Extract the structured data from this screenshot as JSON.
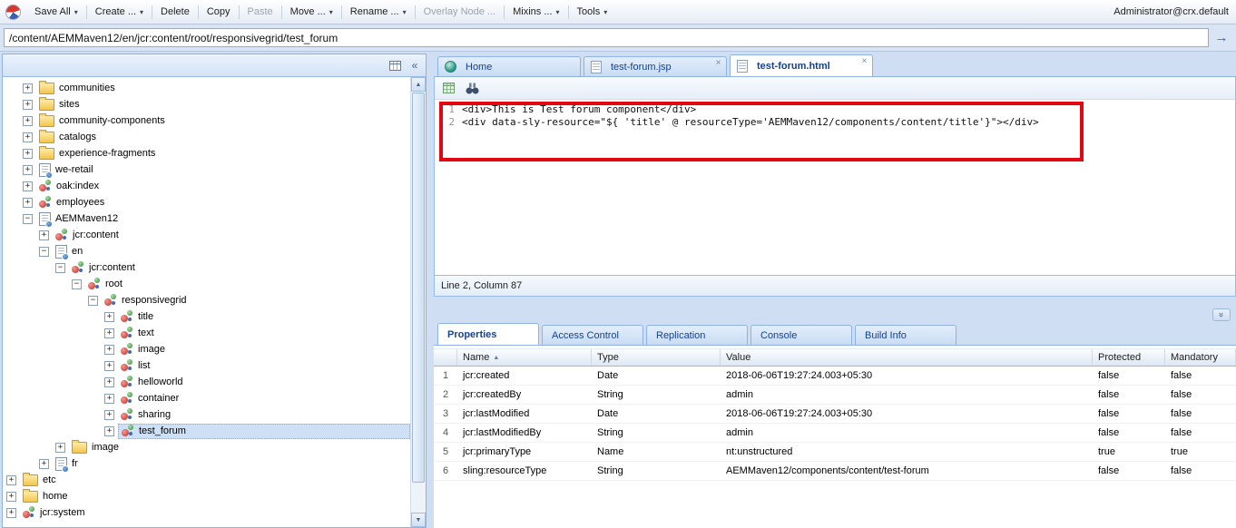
{
  "app": {
    "user": "Administrator@crx.default"
  },
  "toolbar": {
    "items": [
      {
        "label": "Save All",
        "arrow": true,
        "disabled": false
      },
      {
        "label": "Create ...",
        "arrow": true,
        "disabled": false
      },
      {
        "label": "Delete",
        "arrow": false,
        "disabled": false
      },
      {
        "label": "Copy",
        "arrow": false,
        "disabled": false
      },
      {
        "label": "Paste",
        "arrow": false,
        "disabled": true
      },
      {
        "label": "Move ...",
        "arrow": true,
        "disabled": false
      },
      {
        "label": "Rename ...",
        "arrow": true,
        "disabled": false
      },
      {
        "label": "Overlay Node ...",
        "arrow": false,
        "disabled": true
      },
      {
        "label": "Mixins ...",
        "arrow": true,
        "disabled": false
      },
      {
        "label": "Tools",
        "arrow": true,
        "disabled": false
      }
    ]
  },
  "address_bar": {
    "value": "/content/AEMMaven12/en/jcr:content/root/responsivegrid/test_forum"
  },
  "tree": {
    "items": [
      {
        "label": "communities",
        "level": 2,
        "icon": "folder",
        "expander": "plus"
      },
      {
        "label": "sites",
        "level": 2,
        "icon": "folder",
        "expander": "plus"
      },
      {
        "label": "community-components",
        "level": 2,
        "icon": "folder",
        "expander": "plus"
      },
      {
        "label": "catalogs",
        "level": 2,
        "icon": "folder",
        "expander": "plus"
      },
      {
        "label": "experience-fragments",
        "level": 2,
        "icon": "folder",
        "expander": "plus"
      },
      {
        "label": "we-retail",
        "level": 2,
        "icon": "page",
        "expander": "plus"
      },
      {
        "label": "oak:index",
        "level": 2,
        "icon": "node",
        "expander": "plus"
      },
      {
        "label": "employees",
        "level": 2,
        "icon": "node",
        "expander": "plus"
      },
      {
        "label": "AEMMaven12",
        "level": 2,
        "icon": "page",
        "expander": "minus"
      },
      {
        "label": "jcr:content",
        "level": 3,
        "icon": "node",
        "expander": "plus"
      },
      {
        "label": "en",
        "level": 3,
        "icon": "page",
        "expander": "minus"
      },
      {
        "label": "jcr:content",
        "level": 4,
        "icon": "node",
        "expander": "minus"
      },
      {
        "label": "root",
        "level": 5,
        "icon": "node",
        "expander": "minus"
      },
      {
        "label": "responsivegrid",
        "level": 6,
        "icon": "node",
        "expander": "minus"
      },
      {
        "label": "title",
        "level": 7,
        "icon": "node",
        "expander": "plus"
      },
      {
        "label": "text",
        "level": 7,
        "icon": "node",
        "expander": "plus"
      },
      {
        "label": "image",
        "level": 7,
        "icon": "node",
        "expander": "plus"
      },
      {
        "label": "list",
        "level": 7,
        "icon": "node",
        "expander": "plus"
      },
      {
        "label": "helloworld",
        "level": 7,
        "icon": "node",
        "expander": "plus"
      },
      {
        "label": "container",
        "level": 7,
        "icon": "node",
        "expander": "plus"
      },
      {
        "label": "sharing",
        "level": 7,
        "icon": "node",
        "expander": "plus"
      },
      {
        "label": "test_forum",
        "level": 7,
        "icon": "node",
        "expander": "plus",
        "selected": true
      },
      {
        "label": "image",
        "level": 4,
        "icon": "folder",
        "expander": "plus"
      },
      {
        "label": "fr",
        "level": 3,
        "icon": "page",
        "expander": "plus"
      },
      {
        "label": "etc",
        "level": 1,
        "icon": "folder",
        "expander": "plus"
      },
      {
        "label": "home",
        "level": 1,
        "icon": "folder",
        "expander": "plus"
      },
      {
        "label": "jcr:system",
        "level": 1,
        "icon": "node",
        "expander": "plus"
      }
    ]
  },
  "editor": {
    "tabs": [
      {
        "label": "Home",
        "icon": "home",
        "closable": false,
        "active": false
      },
      {
        "label": "test-forum.jsp",
        "icon": "file",
        "closable": true,
        "active": false
      },
      {
        "label": "test-forum.html",
        "icon": "file",
        "closable": true,
        "active": true
      }
    ],
    "lines": [
      {
        "number": "1",
        "code": "<div>This is Test forum component</div>"
      },
      {
        "number": "2",
        "code": "<div data-sly-resource=\"${ 'title' @ resourceType='AEMMaven12/components/content/title'}\"></div>"
      }
    ],
    "status": "Line 2, Column 87"
  },
  "bottom_panel": {
    "tabs": [
      {
        "label": "Properties",
        "active": true
      },
      {
        "label": "Access Control",
        "active": false
      },
      {
        "label": "Replication",
        "active": false
      },
      {
        "label": "Console",
        "active": false
      },
      {
        "label": "Build Info",
        "active": false
      }
    ],
    "table": {
      "columns": [
        "Name",
        "Type",
        "Value",
        "Protected",
        "Mandatory"
      ],
      "rows": [
        {
          "num": "1",
          "name": "jcr:created",
          "type": "Date",
          "value": "2018-06-06T19:27:24.003+05:30",
          "protected": "false",
          "mandatory": "false"
        },
        {
          "num": "2",
          "name": "jcr:createdBy",
          "type": "String",
          "value": "admin",
          "protected": "false",
          "mandatory": "false"
        },
        {
          "num": "3",
          "name": "jcr:lastModified",
          "type": "Date",
          "value": "2018-06-06T19:27:24.003+05:30",
          "protected": "false",
          "mandatory": "false"
        },
        {
          "num": "4",
          "name": "jcr:lastModifiedBy",
          "type": "String",
          "value": "admin",
          "protected": "false",
          "mandatory": "false"
        },
        {
          "num": "5",
          "name": "jcr:primaryType",
          "type": "Name",
          "value": "nt:unstructured",
          "protected": "true",
          "mandatory": "true"
        },
        {
          "num": "6",
          "name": "sling:resourceType",
          "type": "String",
          "value": "AEMMaven12/components/content/test-forum",
          "protected": "false",
          "mandatory": "false"
        }
      ]
    }
  }
}
